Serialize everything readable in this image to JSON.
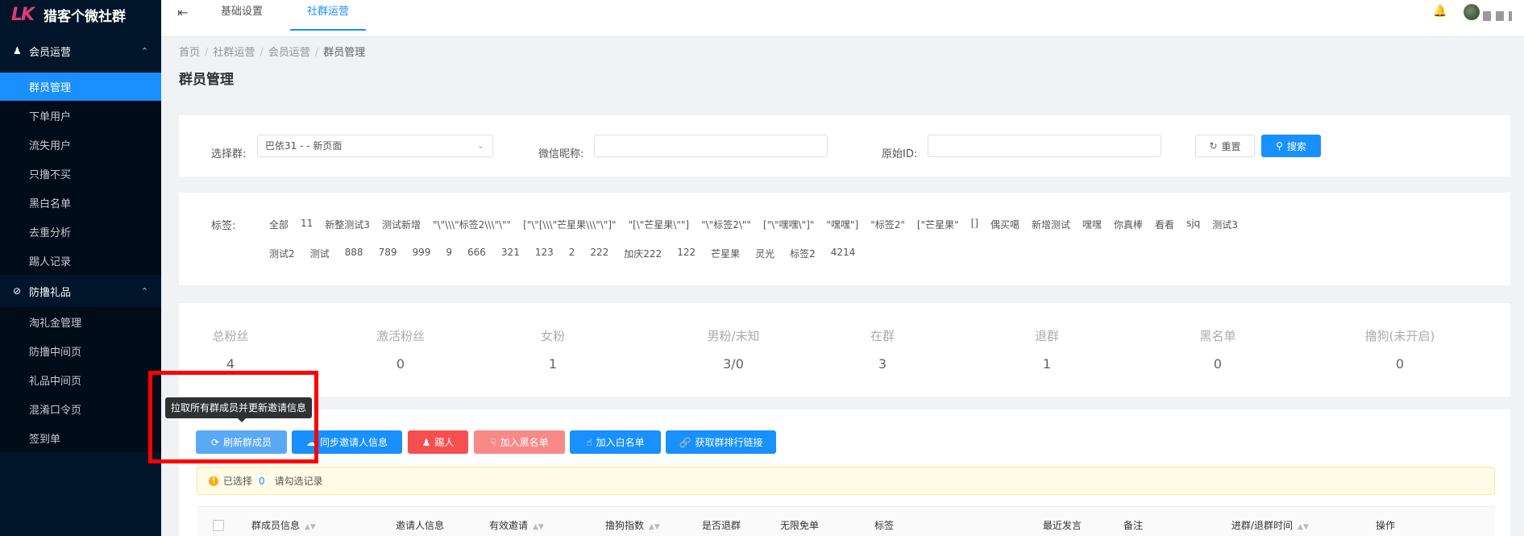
{
  "sidebar": {
    "logo_mark": "LK",
    "logo_text": "猎客个微社群",
    "group1": {
      "label": "会员运营",
      "icon": "users-icon"
    },
    "items1": [
      {
        "label": "群员管理",
        "active": true
      },
      {
        "label": "下单用户",
        "active": false
      },
      {
        "label": "流失用户",
        "active": false
      },
      {
        "label": "只撸不买",
        "active": false
      },
      {
        "label": "黑白名单",
        "active": false
      },
      {
        "label": "去重分析",
        "active": false
      },
      {
        "label": "踢人记录",
        "active": false
      }
    ],
    "group2": {
      "label": "防撸礼品",
      "icon": "eye-off-icon"
    },
    "items2": [
      {
        "label": "淘礼金管理"
      },
      {
        "label": "防撸中间页"
      },
      {
        "label": "礼品中间页"
      },
      {
        "label": "混淆口令页"
      },
      {
        "label": "签到单"
      }
    ]
  },
  "topbar": {
    "tabs": [
      "基础设置",
      "社群运营"
    ],
    "active_tab": "社群运营"
  },
  "breadcrumb": [
    "首页",
    "社群运营",
    "会员运营",
    "群员管理"
  ],
  "page_title": "群员管理",
  "filter": {
    "group_label": "选择群:",
    "group_value": "巴依31 - - 新页面",
    "nickname_label": "微信昵称:",
    "nickname_value": "",
    "original_id_label": "原始ID:",
    "original_id_value": "",
    "reset_label": "重置",
    "search_label": "搜索"
  },
  "tags": {
    "label": "标签:",
    "row1": [
      "全部",
      "11",
      "新整测试3",
      "测试新增",
      "\"\\\"\\\\\\\"标签2\\\\\\\"\\\"\"",
      "[\"\\\"[\\\\\\\"芒星果\\\\\\\"\\\"]\"",
      "\"[\\\"芒星果\\\"\"]",
      "\"\\\"标签2\\\"\"",
      "[\"\\\"嘿嘿\\\"]\"",
      "\"嘿嘿\"]",
      "\"标签2\"",
      "[\"芒星果\"",
      "[]",
      "偶买噶",
      "新增测试",
      "嘿嘿",
      "你真棒",
      "看看",
      "sjq",
      "测试3"
    ],
    "row2": [
      "测试2",
      "测试",
      "888",
      "789",
      "999",
      "9",
      "666",
      "321",
      "123",
      "2",
      "222",
      "加庆222",
      "122",
      "芒星果",
      "灵光",
      "标签2",
      "4214"
    ]
  },
  "stats": [
    {
      "label": "总粉丝",
      "value": "4"
    },
    {
      "label": "激活粉丝",
      "value": "0"
    },
    {
      "label": "女粉",
      "value": "1"
    },
    {
      "label": "男粉/未知",
      "value": "3/0"
    },
    {
      "label": "在群",
      "value": "3"
    },
    {
      "label": "退群",
      "value": "1"
    },
    {
      "label": "黑名单",
      "value": "0"
    },
    {
      "label": "撸狗(未开启)",
      "value": "0"
    }
  ],
  "actions": {
    "refresh": "刷新群成员",
    "sync": "同步邀请人信息",
    "kick": "踢人",
    "blacklist": "加入黑名单",
    "whitelist": "加入白名单",
    "rank_link": "获取群排行链接"
  },
  "tooltip": "拉取所有群成员并更新邀请信息",
  "notice": {
    "selected_label": "已选择",
    "count": "0",
    "hint": "请勾选记录"
  },
  "table_headers": [
    "群成员信息",
    "邀请人信息",
    "有效邀请",
    "撸狗指数",
    "是否退群",
    "无限免单",
    "标签",
    "最近发言",
    "备注",
    "进群/退群时间",
    "操作"
  ],
  "colors": {
    "primary": "#1890ff",
    "danger": "#f5504f",
    "danger_light": "#f78989",
    "highlight": "#ff0000",
    "sidebar": "#001529"
  }
}
